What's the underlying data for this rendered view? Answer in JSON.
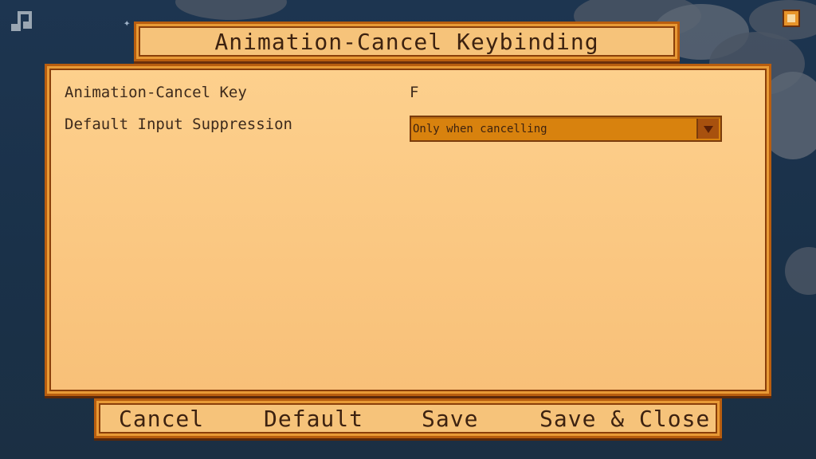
{
  "title": "Animation-Cancel Keybinding",
  "settings": {
    "key_label": "Animation-Cancel Key",
    "key_value": "F",
    "suppression_label": "Default Input Suppression",
    "suppression_value": "Only when cancelling"
  },
  "buttons": {
    "cancel": "Cancel",
    "default": "Default",
    "save": "Save",
    "save_close": "Save & Close"
  },
  "icons": {
    "music": "music-note-icon",
    "fullscreen": "fullscreen-icon",
    "dropdown_arrow": "triangle-down-icon"
  },
  "colors": {
    "panel_fill": "#fdd08d",
    "panel_border": "#b85d0f",
    "dropdown_fill": "#d8820e",
    "text": "#3d2a1c",
    "sky": "#1d3550"
  }
}
